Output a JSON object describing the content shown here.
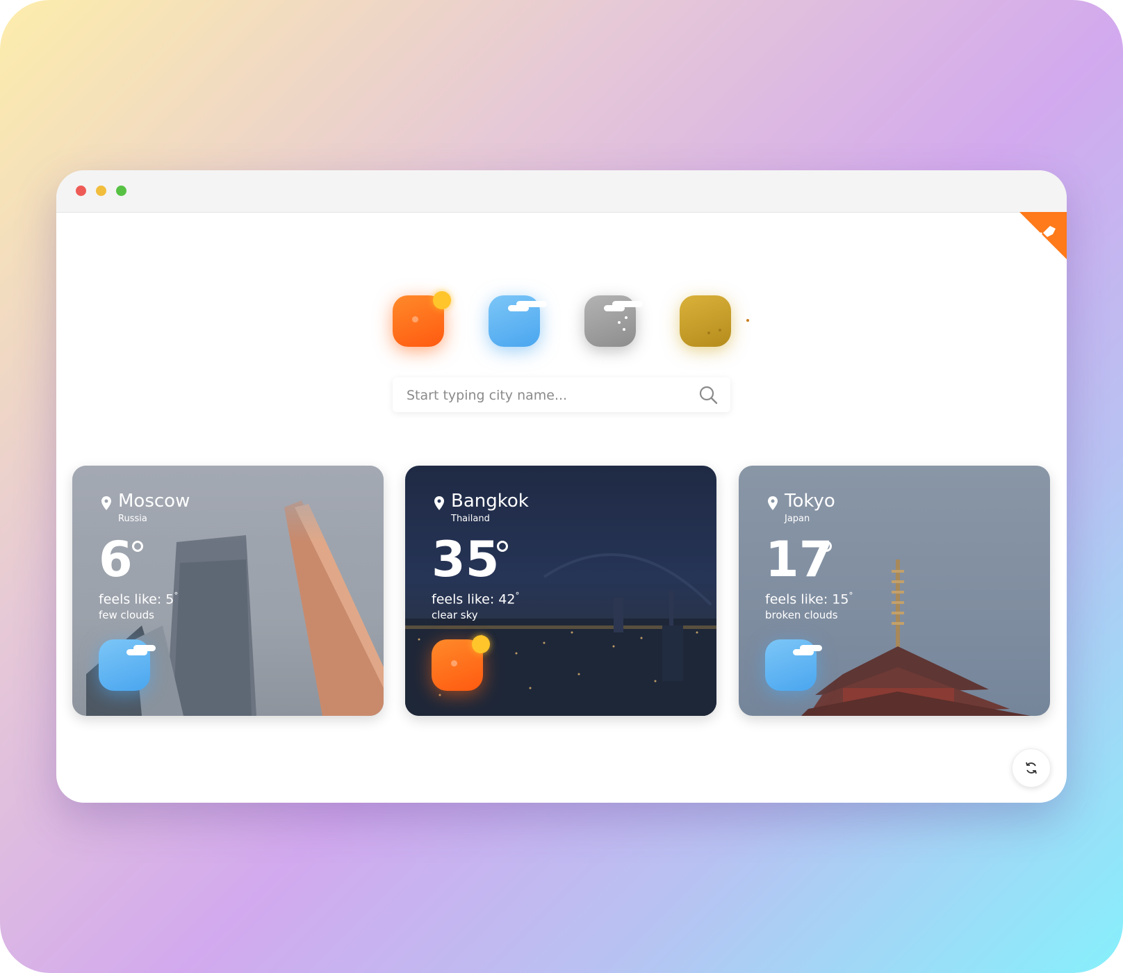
{
  "window": {
    "controls": [
      "close",
      "minimize",
      "maximize"
    ]
  },
  "corner_badge": {
    "icon": "fork-icon",
    "color": "#ff7a1a"
  },
  "icon_row": [
    {
      "name": "sun-icon",
      "color": "#ff6a18"
    },
    {
      "name": "cloud-icon",
      "color": "#5cb3f2"
    },
    {
      "name": "rain-icon",
      "color": "#a0a0a0"
    },
    {
      "name": "haze-icon",
      "color": "#c9a02b"
    }
  ],
  "search": {
    "placeholder": "Start typing city name..."
  },
  "cards": [
    {
      "city": "Moscow",
      "country": "Russia",
      "temp": "6",
      "feels": "feels like: 5",
      "desc": "few clouds",
      "icon": "cloud-icon"
    },
    {
      "city": "Bangkok",
      "country": "Thailand",
      "temp": "35",
      "feels": "feels like: 42",
      "desc": "clear sky",
      "icon": "sun-icon"
    },
    {
      "city": "Tokyo",
      "country": "Japan",
      "temp": "17",
      "feels": "feels like: 15",
      "desc": "broken clouds",
      "icon": "cloud-icon"
    }
  ],
  "refresh": {
    "icon": "refresh-icon"
  }
}
